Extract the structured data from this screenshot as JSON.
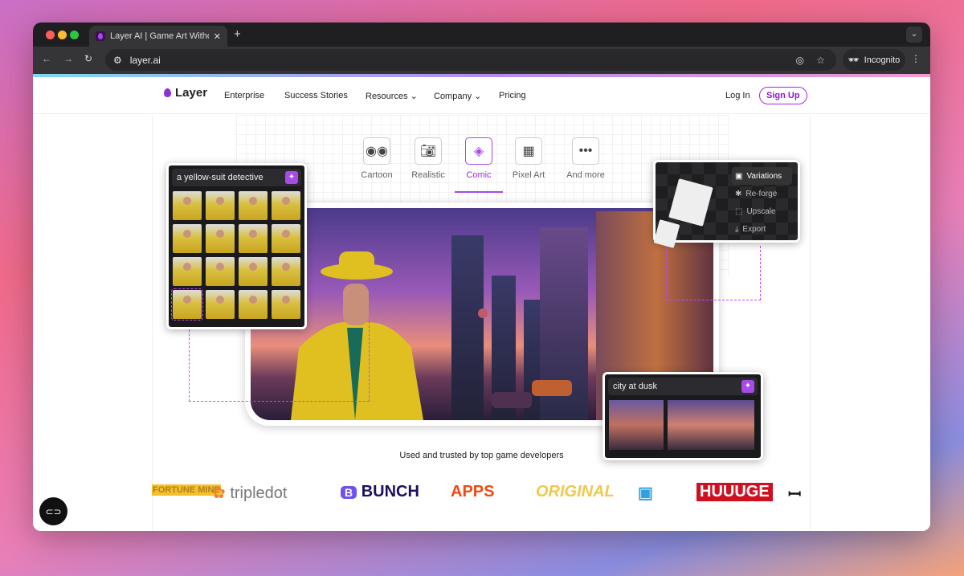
{
  "browser": {
    "tab_title": "Layer AI | Game Art Without L",
    "url": "layer.ai",
    "incognito_label": "Incognito"
  },
  "nav": {
    "brand": "Layer",
    "items": [
      "Enterprise",
      "Success Stories",
      "Resources",
      "Company",
      "Pricing"
    ],
    "login": "Log In",
    "signup": "Sign Up"
  },
  "styles": [
    {
      "label": "Cartoon",
      "icon": "eyes-icon"
    },
    {
      "label": "Realistic",
      "icon": "camera-icon"
    },
    {
      "label": "Comic",
      "icon": "gem-icon",
      "selected": true
    },
    {
      "label": "Pixel Art",
      "icon": "grid-icon"
    },
    {
      "label": "And more",
      "icon": "more-icon"
    }
  ],
  "left_panel": {
    "prompt": "a yellow-suit detective"
  },
  "right_menu": {
    "items": [
      "Variations",
      "Re-forge",
      "Upscale",
      "Export"
    ],
    "active": "Variations"
  },
  "bottom_panel": {
    "prompt": "city at dusk"
  },
  "trusted_text": "Used and trusted by top game developers",
  "logos": [
    "FORTUNE MINE",
    "tripledot",
    "BUNCH",
    "APPS",
    "ORIGINAL",
    "GH",
    "HUUUGE",
    "mustache"
  ],
  "colors": {
    "accent": "#a54ae8"
  }
}
